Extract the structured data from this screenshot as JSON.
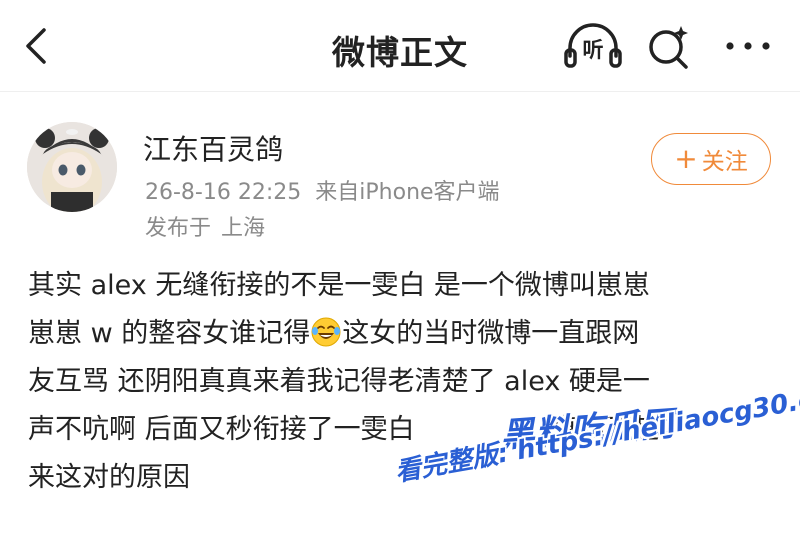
{
  "header": {
    "title": "微博正文",
    "back_icon": "chevron-left-icon",
    "listen_label": "听",
    "search_icon": "search-sparkle-icon",
    "more_icon": "more-dots-icon"
  },
  "author": {
    "name": "江东百灵鸽",
    "date": "26-8-16 22:25",
    "source_prefix": "来自",
    "source": "iPhone客户端",
    "location_prefix": "发布于",
    "location": "上海",
    "follow_label": "关注",
    "follow_plus": "+"
  },
  "post": {
    "line1": "其实 alex 无缝衔接的不是一雯白 是一个微博叫崽崽",
    "line2a": "崽崽 w 的整容女谁记得",
    "line2b": "这女的当时微博一直跟网",
    "line3": "友互骂 还阴阳真真来着我记得老清楚了 alex 硬是一",
    "line4": "声不吭啊 后面又秒衔接了一雯白 ",
    "line4b": "直磕不起",
    "line5": "来这对的原因",
    "emoji": "laugh-cry-emoji"
  },
  "watermark": {
    "brand": "黑料吃瓜网",
    "url_line": "看完整版: https://heiliaocg30.com"
  },
  "colors": {
    "accent": "#f08a3a",
    "meta_text": "#8a8a8a",
    "watermark": "#2a5fd4"
  }
}
